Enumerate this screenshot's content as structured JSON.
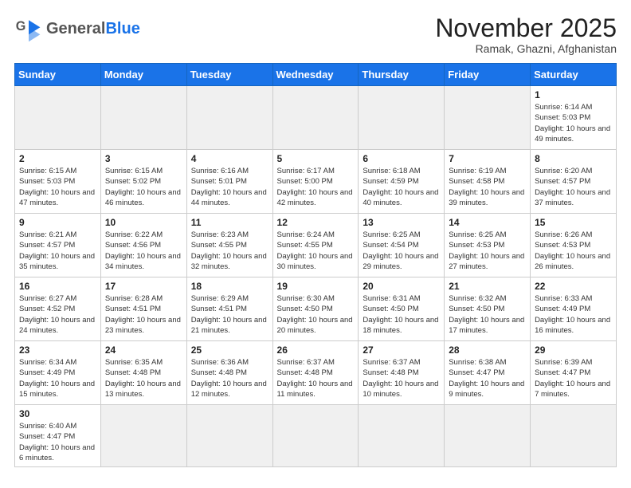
{
  "header": {
    "logo_general": "General",
    "logo_blue": "Blue",
    "month_title": "November 2025",
    "location": "Ramak, Ghazni, Afghanistan"
  },
  "days_of_week": [
    "Sunday",
    "Monday",
    "Tuesday",
    "Wednesday",
    "Thursday",
    "Friday",
    "Saturday"
  ],
  "weeks": [
    [
      {
        "day": "",
        "info": ""
      },
      {
        "day": "",
        "info": ""
      },
      {
        "day": "",
        "info": ""
      },
      {
        "day": "",
        "info": ""
      },
      {
        "day": "",
        "info": ""
      },
      {
        "day": "",
        "info": ""
      },
      {
        "day": "1",
        "info": "Sunrise: 6:14 AM\nSunset: 5:03 PM\nDaylight: 10 hours and 49 minutes."
      }
    ],
    [
      {
        "day": "2",
        "info": "Sunrise: 6:15 AM\nSunset: 5:03 PM\nDaylight: 10 hours and 47 minutes."
      },
      {
        "day": "3",
        "info": "Sunrise: 6:15 AM\nSunset: 5:02 PM\nDaylight: 10 hours and 46 minutes."
      },
      {
        "day": "4",
        "info": "Sunrise: 6:16 AM\nSunset: 5:01 PM\nDaylight: 10 hours and 44 minutes."
      },
      {
        "day": "5",
        "info": "Sunrise: 6:17 AM\nSunset: 5:00 PM\nDaylight: 10 hours and 42 minutes."
      },
      {
        "day": "6",
        "info": "Sunrise: 6:18 AM\nSunset: 4:59 PM\nDaylight: 10 hours and 40 minutes."
      },
      {
        "day": "7",
        "info": "Sunrise: 6:19 AM\nSunset: 4:58 PM\nDaylight: 10 hours and 39 minutes."
      },
      {
        "day": "8",
        "info": "Sunrise: 6:20 AM\nSunset: 4:57 PM\nDaylight: 10 hours and 37 minutes."
      }
    ],
    [
      {
        "day": "9",
        "info": "Sunrise: 6:21 AM\nSunset: 4:57 PM\nDaylight: 10 hours and 35 minutes."
      },
      {
        "day": "10",
        "info": "Sunrise: 6:22 AM\nSunset: 4:56 PM\nDaylight: 10 hours and 34 minutes."
      },
      {
        "day": "11",
        "info": "Sunrise: 6:23 AM\nSunset: 4:55 PM\nDaylight: 10 hours and 32 minutes."
      },
      {
        "day": "12",
        "info": "Sunrise: 6:24 AM\nSunset: 4:55 PM\nDaylight: 10 hours and 30 minutes."
      },
      {
        "day": "13",
        "info": "Sunrise: 6:25 AM\nSunset: 4:54 PM\nDaylight: 10 hours and 29 minutes."
      },
      {
        "day": "14",
        "info": "Sunrise: 6:25 AM\nSunset: 4:53 PM\nDaylight: 10 hours and 27 minutes."
      },
      {
        "day": "15",
        "info": "Sunrise: 6:26 AM\nSunset: 4:53 PM\nDaylight: 10 hours and 26 minutes."
      }
    ],
    [
      {
        "day": "16",
        "info": "Sunrise: 6:27 AM\nSunset: 4:52 PM\nDaylight: 10 hours and 24 minutes."
      },
      {
        "day": "17",
        "info": "Sunrise: 6:28 AM\nSunset: 4:51 PM\nDaylight: 10 hours and 23 minutes."
      },
      {
        "day": "18",
        "info": "Sunrise: 6:29 AM\nSunset: 4:51 PM\nDaylight: 10 hours and 21 minutes."
      },
      {
        "day": "19",
        "info": "Sunrise: 6:30 AM\nSunset: 4:50 PM\nDaylight: 10 hours and 20 minutes."
      },
      {
        "day": "20",
        "info": "Sunrise: 6:31 AM\nSunset: 4:50 PM\nDaylight: 10 hours and 18 minutes."
      },
      {
        "day": "21",
        "info": "Sunrise: 6:32 AM\nSunset: 4:50 PM\nDaylight: 10 hours and 17 minutes."
      },
      {
        "day": "22",
        "info": "Sunrise: 6:33 AM\nSunset: 4:49 PM\nDaylight: 10 hours and 16 minutes."
      }
    ],
    [
      {
        "day": "23",
        "info": "Sunrise: 6:34 AM\nSunset: 4:49 PM\nDaylight: 10 hours and 15 minutes."
      },
      {
        "day": "24",
        "info": "Sunrise: 6:35 AM\nSunset: 4:48 PM\nDaylight: 10 hours and 13 minutes."
      },
      {
        "day": "25",
        "info": "Sunrise: 6:36 AM\nSunset: 4:48 PM\nDaylight: 10 hours and 12 minutes."
      },
      {
        "day": "26",
        "info": "Sunrise: 6:37 AM\nSunset: 4:48 PM\nDaylight: 10 hours and 11 minutes."
      },
      {
        "day": "27",
        "info": "Sunrise: 6:37 AM\nSunset: 4:48 PM\nDaylight: 10 hours and 10 minutes."
      },
      {
        "day": "28",
        "info": "Sunrise: 6:38 AM\nSunset: 4:47 PM\nDaylight: 10 hours and 9 minutes."
      },
      {
        "day": "29",
        "info": "Sunrise: 6:39 AM\nSunset: 4:47 PM\nDaylight: 10 hours and 7 minutes."
      }
    ],
    [
      {
        "day": "30",
        "info": "Sunrise: 6:40 AM\nSunset: 4:47 PM\nDaylight: 10 hours and 6 minutes."
      },
      {
        "day": "",
        "info": ""
      },
      {
        "day": "",
        "info": ""
      },
      {
        "day": "",
        "info": ""
      },
      {
        "day": "",
        "info": ""
      },
      {
        "day": "",
        "info": ""
      },
      {
        "day": "",
        "info": ""
      }
    ]
  ]
}
